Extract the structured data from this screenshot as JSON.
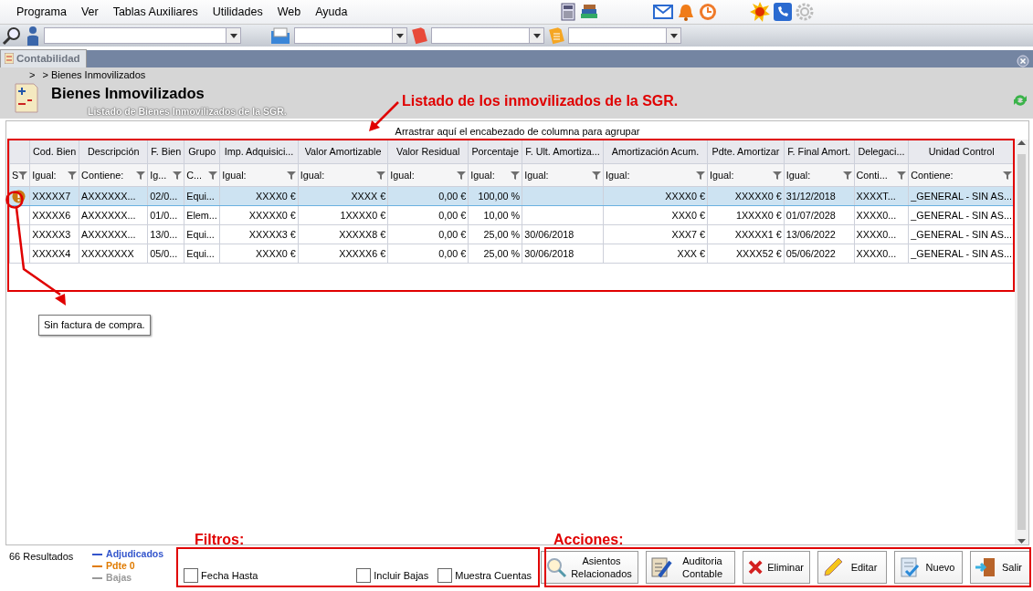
{
  "menu": {
    "items": [
      "Programa",
      "Ver",
      "Tablas Auxiliares",
      "Utilidades",
      "Web",
      "Ayuda"
    ]
  },
  "tab": {
    "label": "Contabilidad",
    "selected": true
  },
  "breadcrumb": [
    ">",
    "> Bienes Inmovilizados"
  ],
  "header": {
    "title": "Bienes Inmovilizados",
    "subtitle": "Listado de Bienes Inmovilizados de la SGR."
  },
  "grid": {
    "group_hint": "Arrastrar aquí el encabezado de columna para agrupar",
    "columns": [
      {
        "filter": "S",
        "kind": "text"
      },
      {
        "label": "Cod. Bien",
        "filter": "Igual:",
        "kind": "text"
      },
      {
        "label": "Descripción",
        "filter": "Contiene:",
        "kind": "text"
      },
      {
        "label": "F. Bien",
        "filter": "Ig...",
        "kind": "text"
      },
      {
        "label": "Grupo",
        "filter": "C...",
        "kind": "text"
      },
      {
        "label": "Imp. Adquisici...",
        "filter": "Igual:",
        "kind": "amount"
      },
      {
        "label": "Valor Amortizable",
        "filter": "Igual:",
        "kind": "amount"
      },
      {
        "label": "Valor Residual",
        "filter": "Igual:",
        "kind": "amount"
      },
      {
        "label": "Porcentaje",
        "filter": "Igual:",
        "kind": "amount"
      },
      {
        "label": "F. Ult. Amortiza...",
        "filter": "Igual:",
        "kind": "text"
      },
      {
        "label": "Amortización Acum.",
        "filter": "Igual:",
        "kind": "amount"
      },
      {
        "label": "Pdte. Amortizar",
        "filter": "Igual:",
        "kind": "amount"
      },
      {
        "label": "F. Final Amort.",
        "filter": "Igual:",
        "kind": "text"
      },
      {
        "label": "Delegaci...",
        "filter": "Conti...",
        "kind": "text"
      },
      {
        "label": "Unidad Control",
        "filter": "Contiene:",
        "kind": "text"
      }
    ],
    "rows": [
      {
        "selected": true,
        "warning": true,
        "cells": [
          "",
          "XXXXX7",
          "AXXXXXX...",
          "02/0...",
          "Equi...",
          "XXXX0 €",
          "XXXX €",
          "0,00 €",
          "100,00 %",
          "",
          "XXXX0 €",
          "XXXXX0 €",
          "31/12/2018",
          "XXXXT...",
          "_GENERAL - SIN AS..."
        ]
      },
      {
        "selected": false,
        "warning": false,
        "cells": [
          "",
          "XXXXX6",
          "AXXXXXX...",
          "01/0...",
          "Elem...",
          "XXXXX0 €",
          "1XXXX0 €",
          "0,00 €",
          "10,00 %",
          "",
          "XXX0 €",
          "1XXXX0 €",
          "01/07/2028",
          "XXXX0...",
          "_GENERAL - SIN AS..."
        ]
      },
      {
        "selected": false,
        "warning": false,
        "cells": [
          "",
          "XXXXX3",
          "AXXXXXX...",
          "13/0...",
          "Equi...",
          "XXXXX3 €",
          "XXXXX8 €",
          "0,00 €",
          "25,00 %",
          "30/06/2018",
          "XXX7 €",
          "XXXXX1 €",
          "13/06/2022",
          "XXXX0...",
          "_GENERAL - SIN AS..."
        ]
      },
      {
        "selected": false,
        "warning": false,
        "cells": [
          "",
          "XXXXX4",
          "XXXXXXXX",
          "05/0...",
          "Equi...",
          "XXXX0 €",
          "XXXXX6 €",
          "0,00 €",
          "25,00 %",
          "30/06/2018",
          "XXX €",
          "XXXX52 €",
          "05/06/2022",
          "XXXX0...",
          "_GENERAL - SIN AS..."
        ]
      }
    ]
  },
  "tooltip": "Sin factura de compra.",
  "status": {
    "results": "66 Resultados",
    "legend": [
      {
        "label": "Adjudicados",
        "color": "#3355cc"
      },
      {
        "label": "Pdte 0",
        "color": "#e07b00"
      },
      {
        "label": "Bajas",
        "color": "#999999"
      }
    ]
  },
  "filters": [
    {
      "label": "Fecha Hasta",
      "checked": false
    },
    {
      "label": "Incluir Bajas",
      "checked": false
    },
    {
      "label": "Muestra Cuentas",
      "checked": false
    }
  ],
  "actions": [
    {
      "label": "Asientos Relacionados",
      "kind": "search"
    },
    {
      "label": "Auditoria Contable",
      "kind": "audit"
    },
    {
      "label": "Eliminar",
      "kind": "delete"
    },
    {
      "label": "Editar",
      "kind": "edit"
    },
    {
      "label": "Nuevo",
      "kind": "new"
    },
    {
      "label": "Salir",
      "kind": "exit"
    }
  ],
  "annotations": [
    {
      "text": "Listado de los inmovilizados de la SGR."
    },
    {
      "text": "Filtros:"
    },
    {
      "text": "Acciones:"
    }
  ]
}
